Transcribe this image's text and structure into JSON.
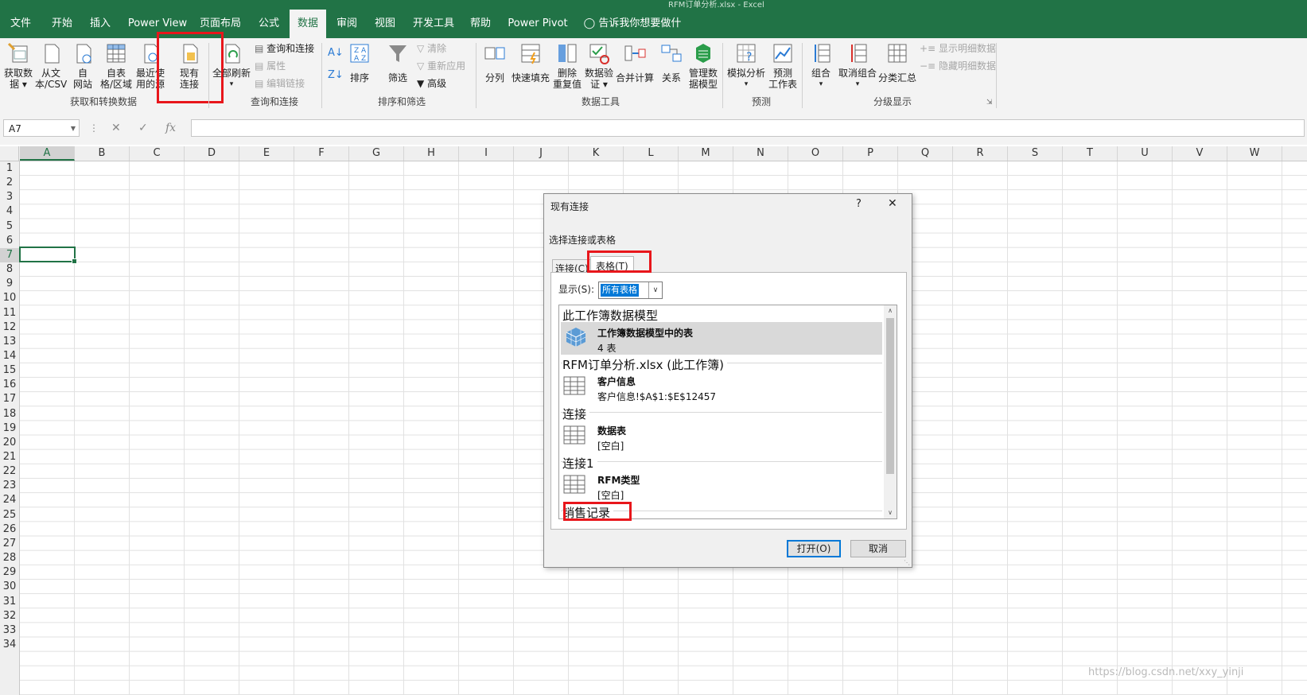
{
  "window_title": "RFM订单分析.xlsx  -  Excel",
  "ribbon_tabs": [
    "文件",
    "开始",
    "插入",
    "Power View",
    "页面布局",
    "公式",
    "数据",
    "审阅",
    "视图",
    "开发工具",
    "帮助",
    "Power Pivot"
  ],
  "active_tab": "数据",
  "tell_me": "告诉我你想要做什么",
  "groups": {
    "get_transform": {
      "label": "获取和转换数据",
      "get_data": [
        "获取数",
        "据 ▾"
      ],
      "from_text": [
        "从文",
        "本/CSV"
      ],
      "from_web": [
        "自",
        "网站"
      ],
      "from_table": [
        "自表",
        "格/区域"
      ],
      "recent_sources": [
        "最近使",
        "用的源"
      ],
      "existing_connections": [
        "现有",
        "连接"
      ]
    },
    "queries": {
      "label": "查询和连接",
      "refresh_all": [
        "全部刷新",
        "▾"
      ],
      "queries_connections": "查询和连接",
      "properties": "属性",
      "edit_links": "编辑链接"
    },
    "sort_filter": {
      "label": "排序和筛选",
      "sort": "排序",
      "filter": "筛选",
      "clear": "清除",
      "reapply": "重新应用",
      "advanced": "高级"
    },
    "data_tools": {
      "label": "数据工具",
      "text_to_columns": "分列",
      "flash_fill": "快速填充",
      "remove_duplicates": [
        "删除",
        "重复值"
      ],
      "data_validation": [
        "数据验",
        "证 ▾"
      ],
      "consolidate": "合并计算",
      "relationships": "关系",
      "manage_model": [
        "管理数",
        "据模型"
      ]
    },
    "forecast": {
      "label": "预测",
      "what_if": [
        "模拟分析",
        "▾"
      ],
      "forecast_sheet": [
        "预测",
        "工作表"
      ]
    },
    "outline": {
      "label": "分级显示",
      "group": [
        "组合",
        "▾"
      ],
      "ungroup": [
        "取消组合",
        "▾"
      ],
      "subtotal": "分类汇总",
      "show_detail": "显示明细数据",
      "hide_detail": "隐藏明细数据"
    }
  },
  "name_box": "A7",
  "formula_icons": {
    "cancel": "✕",
    "enter": "✓",
    "fx": "fx"
  },
  "columns": [
    "A",
    "B",
    "C",
    "D",
    "E",
    "F",
    "G",
    "H",
    "I",
    "J",
    "K",
    "L",
    "M",
    "N",
    "O",
    "P",
    "Q",
    "R",
    "S",
    "T",
    "U",
    "V",
    "W"
  ],
  "rows": [
    "1",
    "2",
    "3",
    "4",
    "5",
    "6",
    "7",
    "8",
    "9",
    "10",
    "11",
    "12",
    "13",
    "14",
    "15",
    "16",
    "17",
    "18",
    "19",
    "20",
    "21",
    "22",
    "23",
    "24",
    "25",
    "26",
    "27",
    "28",
    "29",
    "30",
    "31",
    "32",
    "33",
    "34"
  ],
  "selected_cell": {
    "col": "A",
    "row": "7"
  },
  "dialog": {
    "title": "现有连接",
    "help": "?",
    "close": "✕",
    "prompt": "选择连接或表格",
    "tabs": [
      "连接(C)",
      "表格(T)"
    ],
    "show_label": "显示(S):",
    "show_value": "所有表格",
    "sections": [
      {
        "header": "此工作簿数据模型",
        "items": [
          {
            "name": "工作簿数据模型中的表",
            "sub": "4 表",
            "icon": "cube-icon"
          }
        ]
      },
      {
        "header": "RFM订单分析.xlsx (此工作簿)",
        "items": [
          {
            "name": "客户信息",
            "sub": "客户信息!$A$1:$E$12457",
            "icon": "table-icon"
          }
        ]
      },
      {
        "header": "连接",
        "items": [
          {
            "name": "数据表",
            "sub": "[空白]",
            "icon": "table-icon"
          }
        ]
      },
      {
        "header": "连接1",
        "items": [
          {
            "name": "RFM类型",
            "sub": "[空白]",
            "icon": "table-icon"
          }
        ]
      },
      {
        "header": "销售记录",
        "items": []
      }
    ],
    "open_button": "打开(O)",
    "cancel_button": "取消"
  },
  "watermark": "https://blog.csdn.net/xxy_yinji",
  "colors": {
    "excel_green": "#217346",
    "highlight_red": "#e8161b"
  }
}
